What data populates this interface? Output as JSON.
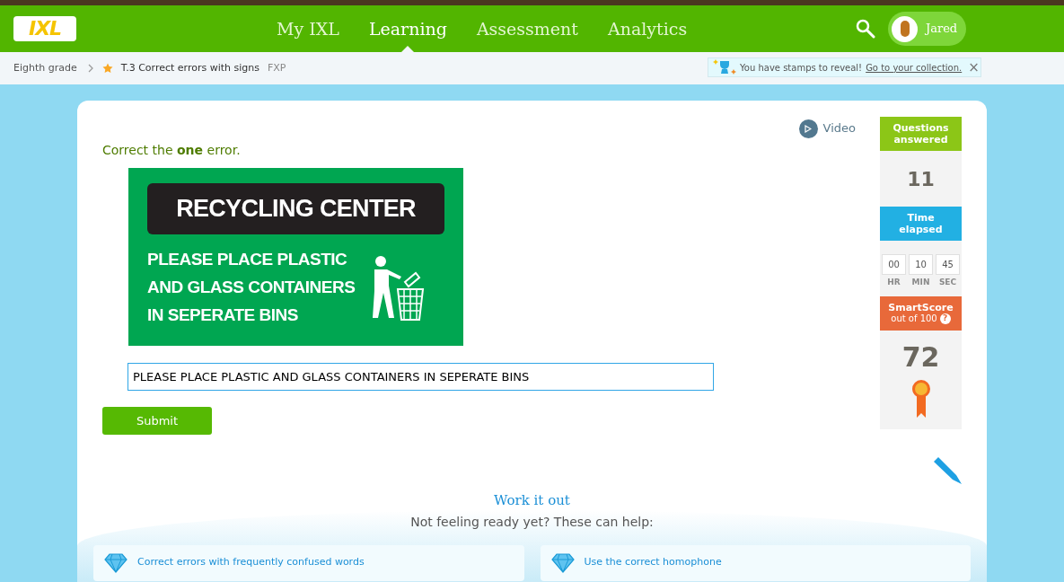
{
  "nav": {
    "logo": "IXL",
    "items": [
      {
        "label": "My IXL",
        "selected": false
      },
      {
        "label": "Learning",
        "selected": true
      },
      {
        "label": "Assessment",
        "selected": false
      },
      {
        "label": "Analytics",
        "selected": false
      }
    ],
    "user": {
      "name": "Jared"
    }
  },
  "breadcrumb": {
    "grade": "Eighth grade",
    "skill": "T.3 Correct errors with signs",
    "code": "FXP"
  },
  "notice": {
    "text": "You have stamps to reveal!",
    "link": "Go to your collection.",
    "close": "×"
  },
  "question": {
    "video": "Video",
    "prompt": "Correct the **one** error.",
    "sign": {
      "title": "RECYCLING CENTER",
      "lines": [
        "PLEASE PLACE PLASTIC",
        "AND GLASS CONTAINERS",
        "IN SEPERATE BINS"
      ]
    },
    "answer": "PLEASE PLACE PLASTIC AND GLASS CONTAINERS IN SEPERATE BINS",
    "submit": "Submit"
  },
  "stats": {
    "questions_label": "Questions answered",
    "questions": "11",
    "time_label": "Time elapsed",
    "time": [
      {
        "value": "00",
        "unit": "HR"
      },
      {
        "value": "10",
        "unit": "MIN"
      },
      {
        "value": "45",
        "unit": "SEC"
      }
    ],
    "score_label": "SmartScore",
    "score_sub": "out of 100",
    "score_help": "?",
    "score": "72"
  },
  "work": {
    "title": "Work it out",
    "subtitle": "Not feeling ready yet? These can help:",
    "links": [
      "Correct errors with frequently confused words",
      "Use the correct homophone"
    ]
  }
}
